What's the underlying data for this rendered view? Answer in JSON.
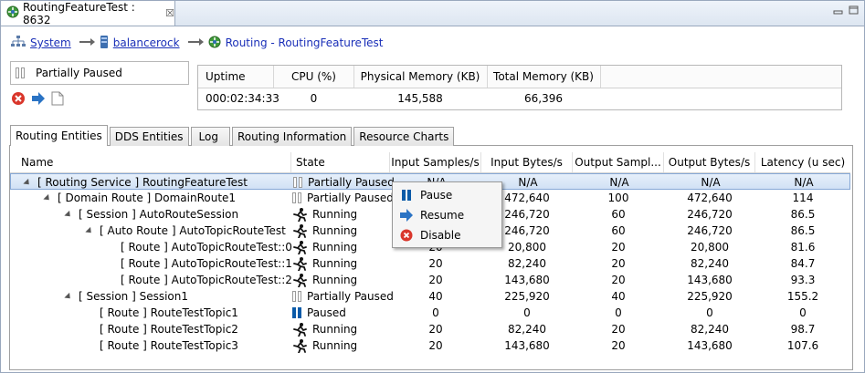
{
  "editor": {
    "tab_title": "RoutingFeatureTest : 8632",
    "close_glyph": "☒"
  },
  "breadcrumb": [
    {
      "label": "System",
      "icon": "network-tree-icon",
      "link": true
    },
    {
      "label": "balancerock",
      "icon": "host-server-icon",
      "link": true
    },
    {
      "label": "Routing - RoutingFeatureTest",
      "icon": "routing-service-icon",
      "link": false
    }
  ],
  "status": {
    "label": "Partially Paused"
  },
  "metrics": {
    "headers": [
      "Uptime",
      "CPU (%)",
      "Physical Memory (KB)",
      "Total Memory (KB)"
    ],
    "values": [
      "000:02:34:33",
      "0",
      "145,588",
      "66,396"
    ]
  },
  "tabs": [
    {
      "label": "Routing Entities",
      "active": true
    },
    {
      "label": "DDS Entities",
      "active": false
    },
    {
      "label": "Log",
      "active": false
    },
    {
      "label": "Routing Information",
      "active": false
    },
    {
      "label": "Resource Charts",
      "active": false
    }
  ],
  "grid": {
    "columns": [
      "Name",
      "State",
      "Input Samples/s",
      "Input Bytes/s",
      "Output Sampl...",
      "Output Bytes/s",
      "Latency (u sec)"
    ],
    "rows": [
      {
        "name": "[ Routing Service ] RoutingFeatureTest",
        "level": 0,
        "expander": true,
        "state": "Partially Paused",
        "state_icon": "partially-paused",
        "in_samples": "N/A",
        "in_bytes": "N/A",
        "out_samples": "N/A",
        "out_bytes": "N/A",
        "latency": "N/A",
        "selected": true
      },
      {
        "name": "[ Domain Route ] DomainRoute1",
        "level": 1,
        "expander": true,
        "state": "Partially Paused",
        "state_icon": "partially-paused",
        "in_samples": "",
        "in_bytes": "472,640",
        "out_samples": "100",
        "out_bytes": "472,640",
        "latency": "114",
        "selected": false
      },
      {
        "name": "[ Session ] AutoRouteSession",
        "level": 2,
        "expander": true,
        "state": "Running",
        "state_icon": "running",
        "in_samples": "",
        "in_bytes": "246,720",
        "out_samples": "60",
        "out_bytes": "246,720",
        "latency": "86.5",
        "selected": false
      },
      {
        "name": "[ Auto Route ] AutoTopicRouteTest",
        "level": 3,
        "expander": true,
        "state": "Running",
        "state_icon": "running",
        "in_samples": "",
        "in_bytes": "246,720",
        "out_samples": "60",
        "out_bytes": "246,720",
        "latency": "86.5",
        "selected": false
      },
      {
        "name": "[ Route ] AutoTopicRouteTest::0",
        "level": 4,
        "expander": false,
        "state": "Running",
        "state_icon": "running",
        "in_samples": "20",
        "in_bytes": "20,800",
        "out_samples": "20",
        "out_bytes": "20,800",
        "latency": "81.6",
        "selected": false
      },
      {
        "name": "[ Route ] AutoTopicRouteTest::1",
        "level": 4,
        "expander": false,
        "state": "Running",
        "state_icon": "running",
        "in_samples": "20",
        "in_bytes": "82,240",
        "out_samples": "20",
        "out_bytes": "82,240",
        "latency": "84.7",
        "selected": false
      },
      {
        "name": "[ Route ] AutoTopicRouteTest::2",
        "level": 4,
        "expander": false,
        "state": "Running",
        "state_icon": "running",
        "in_samples": "20",
        "in_bytes": "143,680",
        "out_samples": "20",
        "out_bytes": "143,680",
        "latency": "93.3",
        "selected": false
      },
      {
        "name": "[ Session ] Session1",
        "level": 2,
        "expander": true,
        "state": "Partially Paused",
        "state_icon": "partially-paused",
        "in_samples": "40",
        "in_bytes": "225,920",
        "out_samples": "40",
        "out_bytes": "225,920",
        "latency": "155.2",
        "selected": false
      },
      {
        "name": "[ Route ] RouteTestTopic1",
        "level": 3,
        "expander": false,
        "state": "Paused",
        "state_icon": "paused",
        "in_samples": "0",
        "in_bytes": "0",
        "out_samples": "0",
        "out_bytes": "0",
        "latency": "0",
        "selected": false
      },
      {
        "name": "[ Route ] RouteTestTopic2",
        "level": 3,
        "expander": false,
        "state": "Running",
        "state_icon": "running",
        "in_samples": "20",
        "in_bytes": "82,240",
        "out_samples": "20",
        "out_bytes": "82,240",
        "latency": "98.7",
        "selected": false
      },
      {
        "name": "[ Route ] RouteTestTopic3",
        "level": 3,
        "expander": false,
        "state": "Running",
        "state_icon": "running",
        "in_samples": "20",
        "in_bytes": "143,680",
        "out_samples": "20",
        "out_bytes": "143,680",
        "latency": "107.6",
        "selected": false
      }
    ]
  },
  "context_menu": {
    "items": [
      {
        "label": "Pause",
        "icon": "pause-icon"
      },
      {
        "label": "Resume",
        "icon": "resume-arrow-icon"
      },
      {
        "label": "Disable",
        "icon": "disable-icon"
      }
    ]
  },
  "colors": {
    "link": "#1a2fb8",
    "pause_blue": "#0a5aa8",
    "disable_red": "#d9362b",
    "selection": "#d1e1f5"
  }
}
